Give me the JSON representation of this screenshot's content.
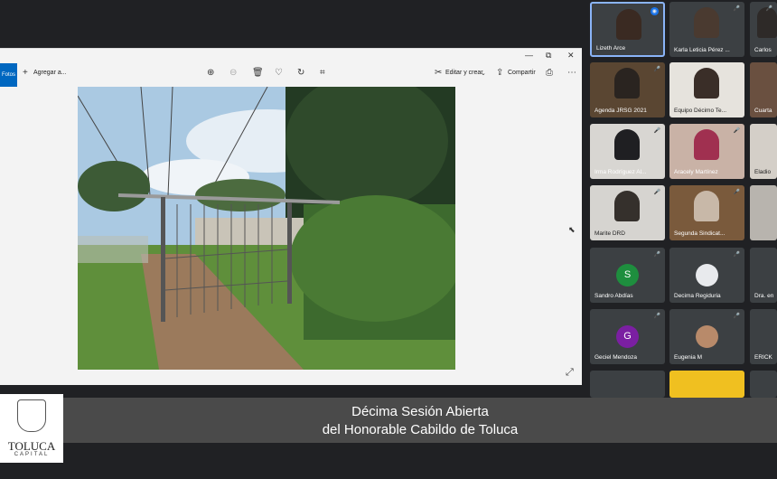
{
  "viewer": {
    "app_tab": "Fotos",
    "add_to": "Agregar a...",
    "edit_create": "Editar y crear",
    "share": "Compartir",
    "min": "—",
    "max": "⧉",
    "close": "✕"
  },
  "participants": [
    {
      "name": "Lizeth Arce",
      "mic": "",
      "kind": "video"
    },
    {
      "name": "Karla Leticia Pérez ...",
      "mic": "🎤",
      "kind": "video"
    },
    {
      "name": "Carlos",
      "mic": "🎤",
      "kind": "video"
    },
    {
      "name": "Agenda JRSG 2021",
      "mic": "🎤",
      "kind": "video"
    },
    {
      "name": "Equipo Décimo Te...",
      "mic": "",
      "kind": "video"
    },
    {
      "name": "Cuarta",
      "mic": "",
      "kind": "video"
    },
    {
      "name": "Irma Rodríguez Al...",
      "mic": "🎤",
      "kind": "video"
    },
    {
      "name": "Aracely Martínez",
      "mic": "🎤",
      "kind": "video"
    },
    {
      "name": "Eladio",
      "mic": "",
      "kind": "video"
    },
    {
      "name": "Marite DRD",
      "mic": "🎤",
      "kind": "video"
    },
    {
      "name": "Segunda Sindicat...",
      "mic": "🎤",
      "kind": "video"
    },
    {
      "name": "",
      "mic": "",
      "kind": "video"
    },
    {
      "name": "Sandro Abdías",
      "mic": "🎤",
      "kind": "avatar",
      "initial": "S",
      "color": "#1e8e3e"
    },
    {
      "name": "Decima Regiduria",
      "mic": "🎤",
      "kind": "photo"
    },
    {
      "name": "Dra. en",
      "mic": "",
      "kind": "video"
    },
    {
      "name": "Geciel Mendoza",
      "mic": "🎤",
      "kind": "avatar",
      "initial": "G",
      "color": "#7b1fa2"
    },
    {
      "name": "Eugenia M",
      "mic": "🎤",
      "kind": "photo"
    },
    {
      "name": "ERICK",
      "mic": "",
      "kind": "video"
    }
  ],
  "banner": {
    "line1": "Décima Sesión Abierta",
    "line2": "del Honorable Cabildo de Toluca"
  },
  "logo": {
    "name": "TOLUCA",
    "sub": "CAPITAL"
  }
}
